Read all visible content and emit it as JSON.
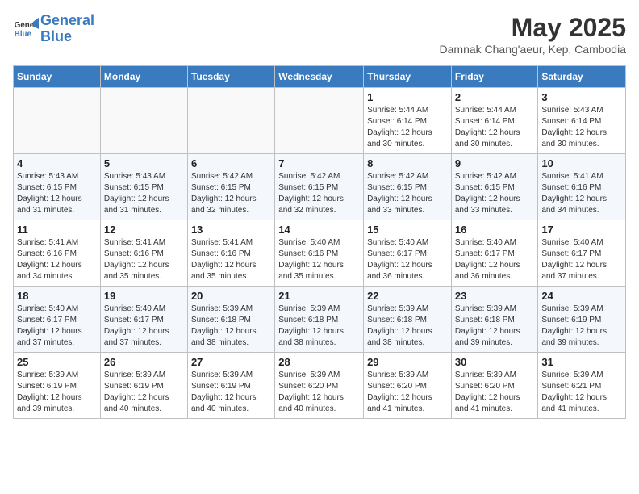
{
  "header": {
    "logo_line1": "General",
    "logo_line2": "Blue",
    "month": "May 2025",
    "location": "Damnak Chang'aeur, Kep, Cambodia"
  },
  "weekdays": [
    "Sunday",
    "Monday",
    "Tuesday",
    "Wednesday",
    "Thursday",
    "Friday",
    "Saturday"
  ],
  "weeks": [
    [
      {
        "day": "",
        "info": ""
      },
      {
        "day": "",
        "info": ""
      },
      {
        "day": "",
        "info": ""
      },
      {
        "day": "",
        "info": ""
      },
      {
        "day": "1",
        "info": "Sunrise: 5:44 AM\nSunset: 6:14 PM\nDaylight: 12 hours\nand 30 minutes."
      },
      {
        "day": "2",
        "info": "Sunrise: 5:44 AM\nSunset: 6:14 PM\nDaylight: 12 hours\nand 30 minutes."
      },
      {
        "day": "3",
        "info": "Sunrise: 5:43 AM\nSunset: 6:14 PM\nDaylight: 12 hours\nand 30 minutes."
      }
    ],
    [
      {
        "day": "4",
        "info": "Sunrise: 5:43 AM\nSunset: 6:15 PM\nDaylight: 12 hours\nand 31 minutes."
      },
      {
        "day": "5",
        "info": "Sunrise: 5:43 AM\nSunset: 6:15 PM\nDaylight: 12 hours\nand 31 minutes."
      },
      {
        "day": "6",
        "info": "Sunrise: 5:42 AM\nSunset: 6:15 PM\nDaylight: 12 hours\nand 32 minutes."
      },
      {
        "day": "7",
        "info": "Sunrise: 5:42 AM\nSunset: 6:15 PM\nDaylight: 12 hours\nand 32 minutes."
      },
      {
        "day": "8",
        "info": "Sunrise: 5:42 AM\nSunset: 6:15 PM\nDaylight: 12 hours\nand 33 minutes."
      },
      {
        "day": "9",
        "info": "Sunrise: 5:42 AM\nSunset: 6:15 PM\nDaylight: 12 hours\nand 33 minutes."
      },
      {
        "day": "10",
        "info": "Sunrise: 5:41 AM\nSunset: 6:16 PM\nDaylight: 12 hours\nand 34 minutes."
      }
    ],
    [
      {
        "day": "11",
        "info": "Sunrise: 5:41 AM\nSunset: 6:16 PM\nDaylight: 12 hours\nand 34 minutes."
      },
      {
        "day": "12",
        "info": "Sunrise: 5:41 AM\nSunset: 6:16 PM\nDaylight: 12 hours\nand 35 minutes."
      },
      {
        "day": "13",
        "info": "Sunrise: 5:41 AM\nSunset: 6:16 PM\nDaylight: 12 hours\nand 35 minutes."
      },
      {
        "day": "14",
        "info": "Sunrise: 5:40 AM\nSunset: 6:16 PM\nDaylight: 12 hours\nand 35 minutes."
      },
      {
        "day": "15",
        "info": "Sunrise: 5:40 AM\nSunset: 6:17 PM\nDaylight: 12 hours\nand 36 minutes."
      },
      {
        "day": "16",
        "info": "Sunrise: 5:40 AM\nSunset: 6:17 PM\nDaylight: 12 hours\nand 36 minutes."
      },
      {
        "day": "17",
        "info": "Sunrise: 5:40 AM\nSunset: 6:17 PM\nDaylight: 12 hours\nand 37 minutes."
      }
    ],
    [
      {
        "day": "18",
        "info": "Sunrise: 5:40 AM\nSunset: 6:17 PM\nDaylight: 12 hours\nand 37 minutes."
      },
      {
        "day": "19",
        "info": "Sunrise: 5:40 AM\nSunset: 6:17 PM\nDaylight: 12 hours\nand 37 minutes."
      },
      {
        "day": "20",
        "info": "Sunrise: 5:39 AM\nSunset: 6:18 PM\nDaylight: 12 hours\nand 38 minutes."
      },
      {
        "day": "21",
        "info": "Sunrise: 5:39 AM\nSunset: 6:18 PM\nDaylight: 12 hours\nand 38 minutes."
      },
      {
        "day": "22",
        "info": "Sunrise: 5:39 AM\nSunset: 6:18 PM\nDaylight: 12 hours\nand 38 minutes."
      },
      {
        "day": "23",
        "info": "Sunrise: 5:39 AM\nSunset: 6:18 PM\nDaylight: 12 hours\nand 39 minutes."
      },
      {
        "day": "24",
        "info": "Sunrise: 5:39 AM\nSunset: 6:19 PM\nDaylight: 12 hours\nand 39 minutes."
      }
    ],
    [
      {
        "day": "25",
        "info": "Sunrise: 5:39 AM\nSunset: 6:19 PM\nDaylight: 12 hours\nand 39 minutes."
      },
      {
        "day": "26",
        "info": "Sunrise: 5:39 AM\nSunset: 6:19 PM\nDaylight: 12 hours\nand 40 minutes."
      },
      {
        "day": "27",
        "info": "Sunrise: 5:39 AM\nSunset: 6:19 PM\nDaylight: 12 hours\nand 40 minutes."
      },
      {
        "day": "28",
        "info": "Sunrise: 5:39 AM\nSunset: 6:20 PM\nDaylight: 12 hours\nand 40 minutes."
      },
      {
        "day": "29",
        "info": "Sunrise: 5:39 AM\nSunset: 6:20 PM\nDaylight: 12 hours\nand 41 minutes."
      },
      {
        "day": "30",
        "info": "Sunrise: 5:39 AM\nSunset: 6:20 PM\nDaylight: 12 hours\nand 41 minutes."
      },
      {
        "day": "31",
        "info": "Sunrise: 5:39 AM\nSunset: 6:21 PM\nDaylight: 12 hours\nand 41 minutes."
      }
    ]
  ]
}
